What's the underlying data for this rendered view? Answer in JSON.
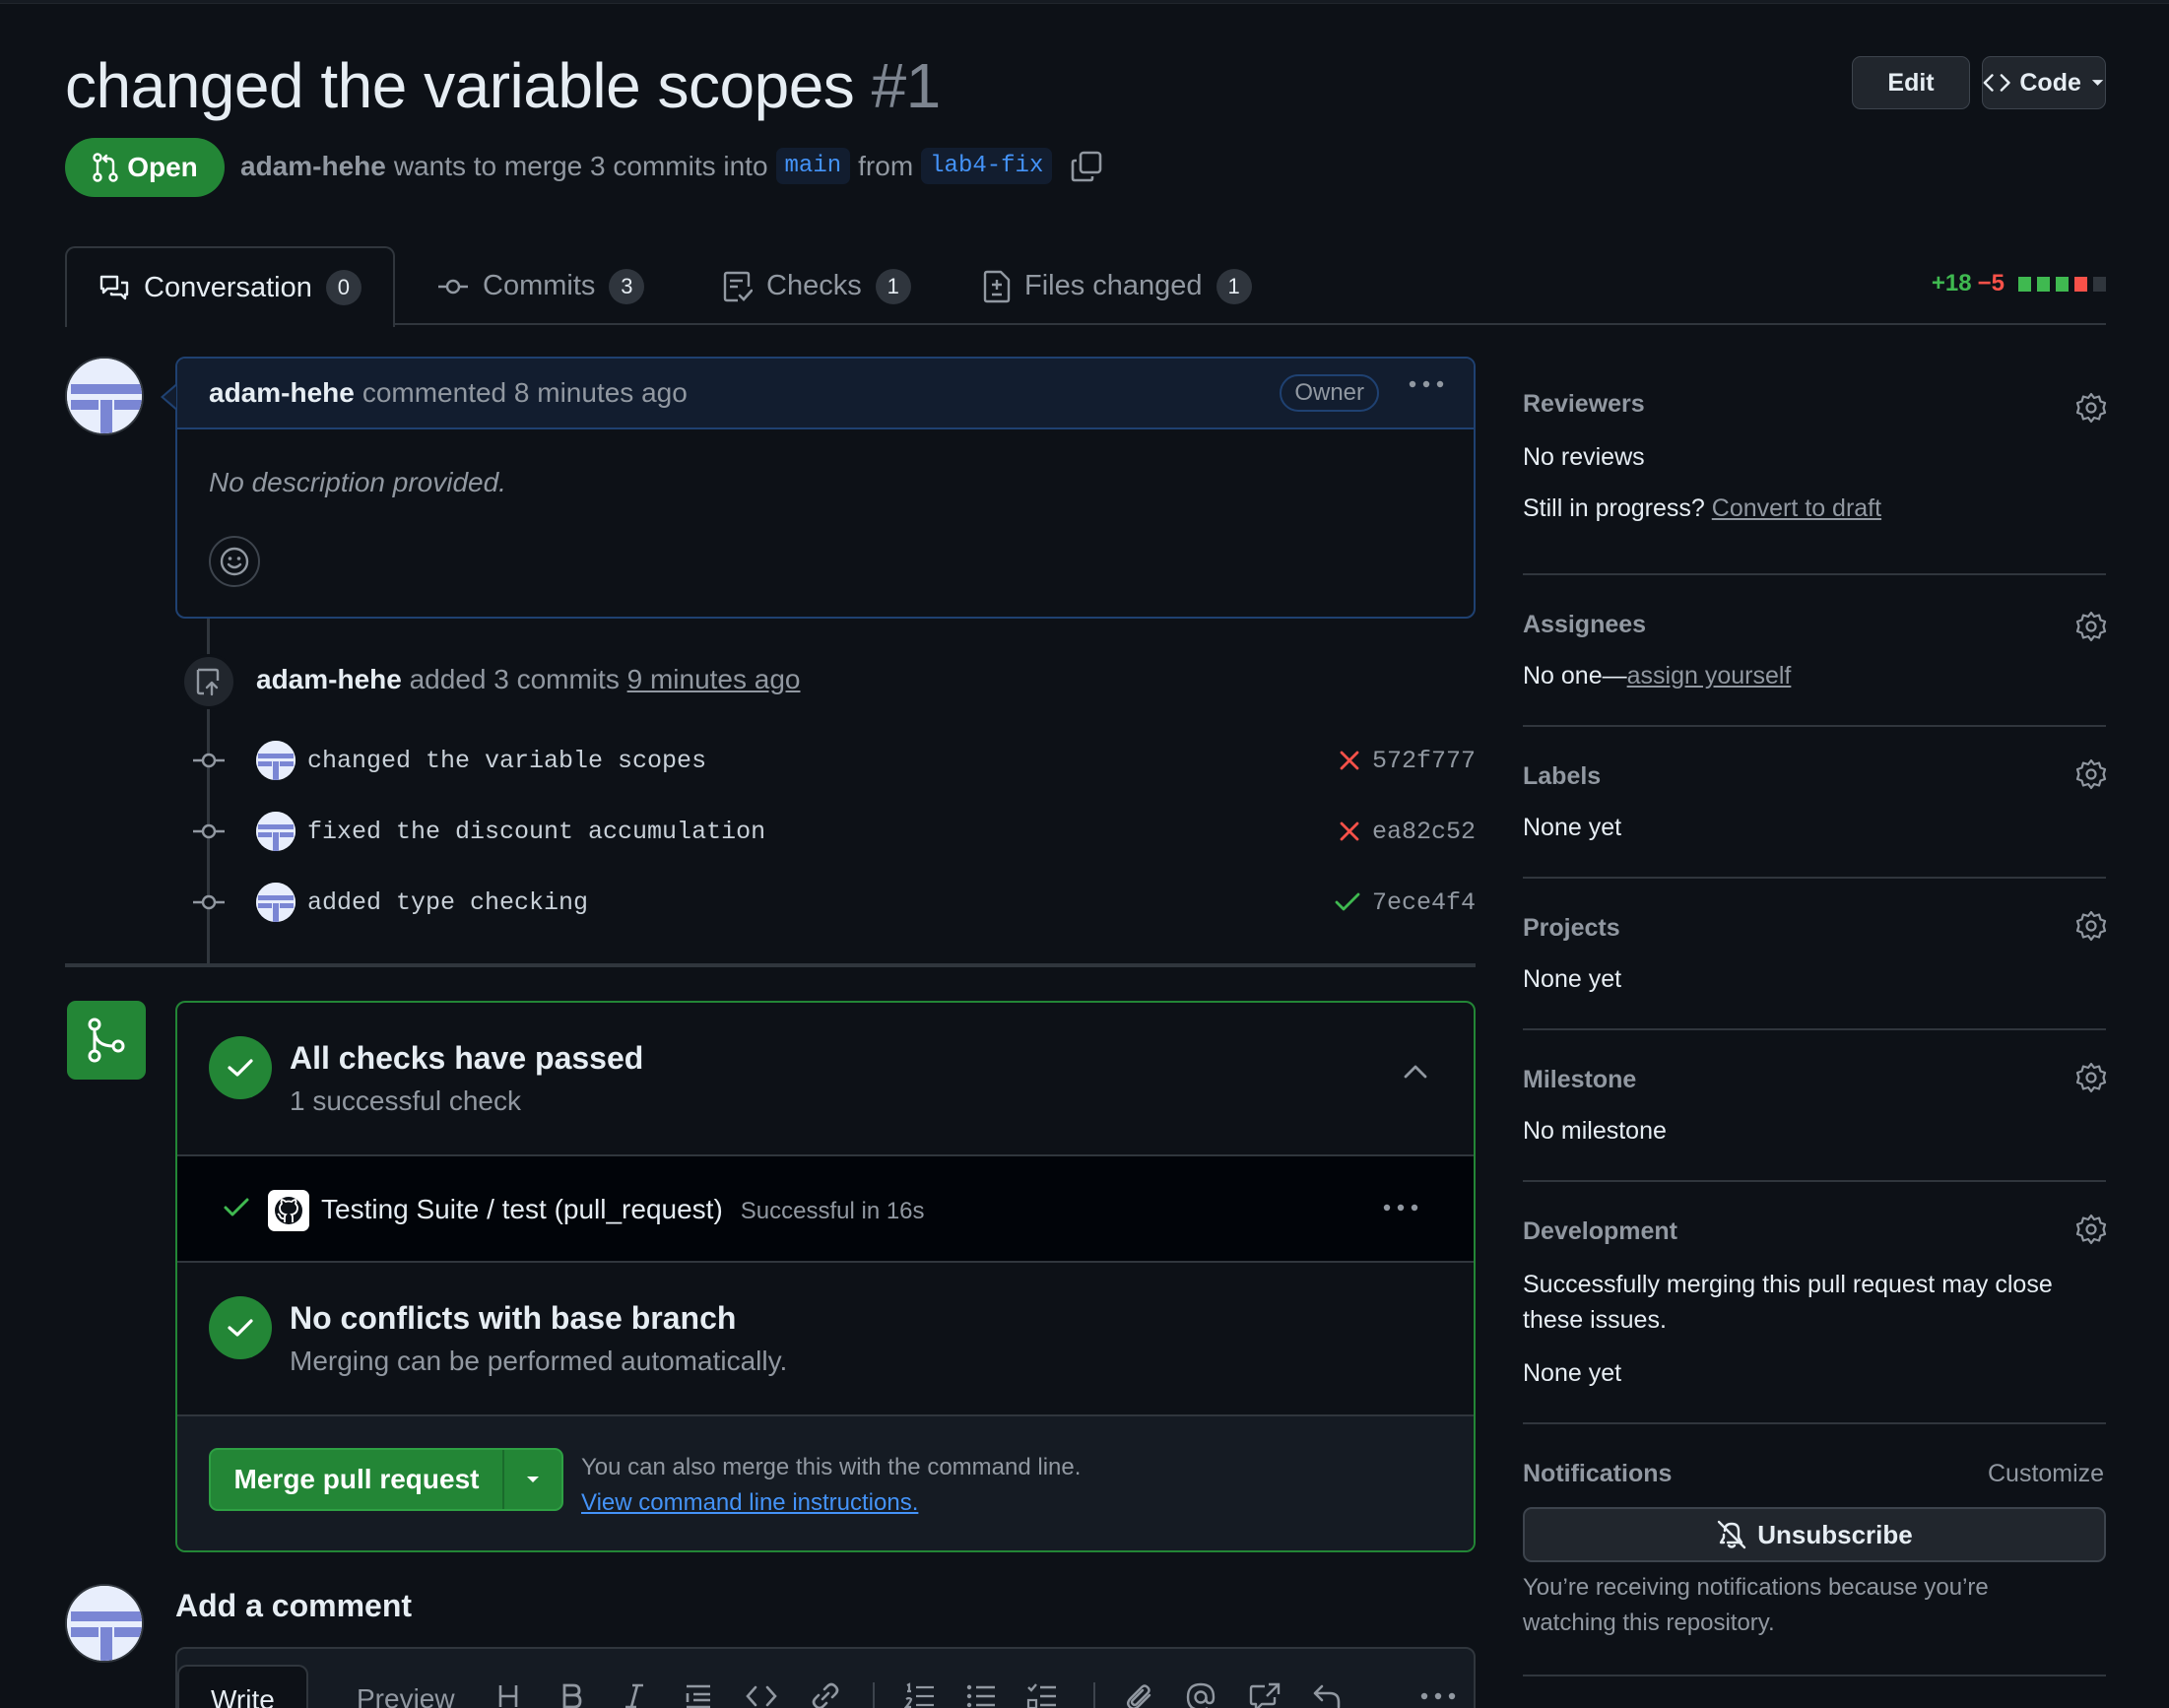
{
  "pr": {
    "title": "changed the variable scopes",
    "number": "#1",
    "state": "Open",
    "author": "adam-hehe",
    "merge_text": "wants to merge 3 commits into",
    "base_branch": "main",
    "from_text": "from",
    "head_branch": "lab4-fix"
  },
  "header_buttons": {
    "edit": "Edit",
    "code": "Code"
  },
  "tabs": [
    {
      "label": "Conversation",
      "count": "0"
    },
    {
      "label": "Commits",
      "count": "3"
    },
    {
      "label": "Checks",
      "count": "1"
    },
    {
      "label": "Files changed",
      "count": "1"
    }
  ],
  "diffstat": {
    "additions": "+18",
    "deletions": "−5"
  },
  "comment": {
    "author": "adam-hehe",
    "action": "commented 8 minutes ago",
    "role": "Owner",
    "body": "No description provided."
  },
  "commit_event": {
    "author": "adam-hehe",
    "action": "added 3 commits",
    "time": "9 minutes ago"
  },
  "commits": [
    {
      "message": "changed the variable scopes",
      "sha": "572f777",
      "status": "fail"
    },
    {
      "message": "fixed the discount accumulation",
      "sha": "ea82c52",
      "status": "fail"
    },
    {
      "message": "added type checking",
      "sha": "7ece4f4",
      "status": "pass"
    }
  ],
  "merge_box": {
    "checks_title": "All checks have passed",
    "checks_sub": "1 successful check",
    "check_name": "Testing Suite / test (pull_request)",
    "check_status": "Successful in 16s",
    "conflict_title": "No conflicts with base branch",
    "conflict_sub": "Merging can be performed automatically.",
    "merge_button": "Merge pull request",
    "cli_note": "You can also merge this with the command line.",
    "cli_link": "View command line instructions."
  },
  "add_comment": {
    "title": "Add a comment",
    "write_tab": "Write",
    "preview_tab": "Preview"
  },
  "sidebar": {
    "reviewers": {
      "title": "Reviewers",
      "value": "No reviews",
      "hint": "Still in progress?",
      "link": "Convert to draft"
    },
    "assignees": {
      "title": "Assignees",
      "value": "No one—",
      "link": "assign yourself"
    },
    "labels": {
      "title": "Labels",
      "value": "None yet"
    },
    "projects": {
      "title": "Projects",
      "value": "None yet"
    },
    "milestone": {
      "title": "Milestone",
      "value": "No milestone"
    },
    "development": {
      "title": "Development",
      "desc": "Successfully merging this pull request may close these issues.",
      "value": "None yet"
    },
    "notifications": {
      "title": "Notifications",
      "customize": "Customize",
      "button": "Unsubscribe",
      "note": "You’re receiving notifications because you’re watching this repository."
    }
  },
  "colors": {
    "open_green": "#238636",
    "link_blue": "#4493f8",
    "fail_red": "#f85149",
    "pass_green": "#3fb950"
  }
}
